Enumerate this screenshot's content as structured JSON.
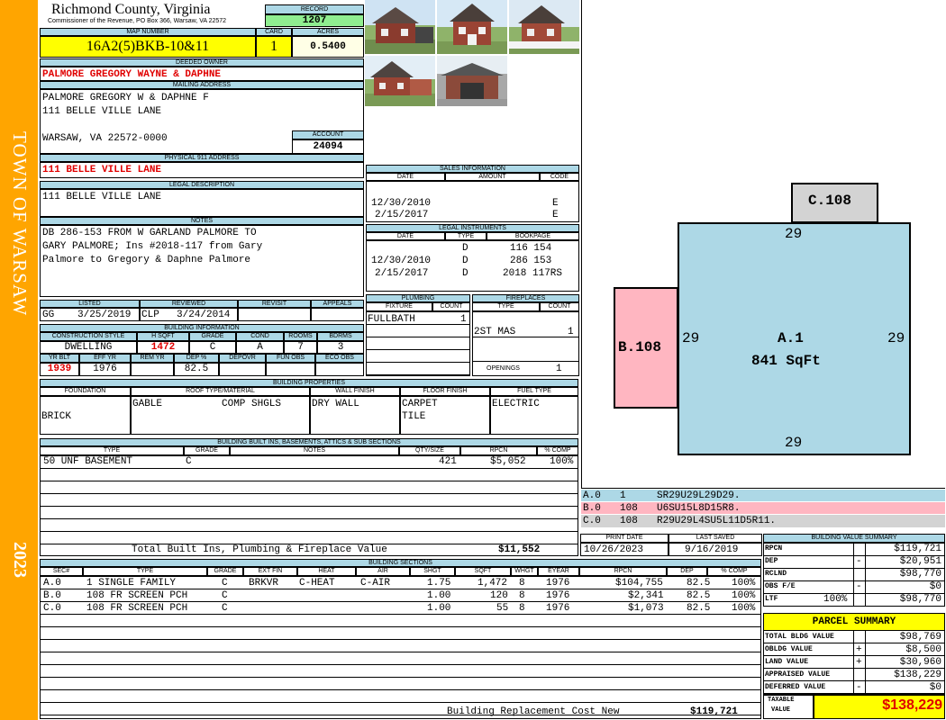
{
  "sidebar": {
    "town": "TOWN OF WARSAW",
    "year": "2023"
  },
  "header": {
    "county": "Richmond County, Virginia",
    "commissioner": "Commissioner of the Revenue, PO Box 366, Warsaw, VA 22572",
    "record_label": "RECORD",
    "record": "1207"
  },
  "parcel": {
    "map_number_label": "MAP NUMBER",
    "map_number": "16A2(5)BKB-10&11",
    "card_label": "CARD",
    "card": "1",
    "acres_label": "ACRES",
    "acres": "0.5400"
  },
  "owner": {
    "label": "DEEDED OWNER",
    "name": "PALMORE GREGORY WAYNE & DAPHNE",
    "mailing_label": "MAILING ADDRESS",
    "mailing": [
      "PALMORE GREGORY W & DAPHNE F",
      "111 BELLE VILLE LANE",
      "WARSAW, VA 22572-0000"
    ],
    "account_label": "ACCOUNT",
    "account": "24094"
  },
  "physical": {
    "label": "PHYSICAL 911 ADDRESS",
    "address": "111 BELLE VILLE LANE"
  },
  "legal": {
    "label": "LEGAL DESCRIPTION",
    "text": "111 BELLE VILLE LANE"
  },
  "notes": {
    "label": "NOTES",
    "lines": [
      "DB 286-153 FROM W GARLAND PALMORE TO",
      "GARY PALMORE; Ins #2018-117 from Gary",
      "Palmore to Gregory & Daphne Palmore"
    ]
  },
  "review": {
    "listed_label": "LISTED",
    "reviewed_label": "REVIEWED",
    "revisit_label": "REVISIT",
    "appeals_label": "APPEALS",
    "listed_by": "GG",
    "listed_date": "3/25/2019",
    "reviewed_by": "CLP",
    "reviewed_date": "3/24/2014"
  },
  "building_info": {
    "label": "BUILDING INFORMATION",
    "row1_labels": [
      "CONSTRUCTION STYLE",
      "H SQFT",
      "GRADE",
      "COND",
      "ROOMS",
      "BDRMS"
    ],
    "row1_values": [
      "DWELLING",
      "1472",
      "C",
      "A",
      "7",
      "3"
    ],
    "row2_labels": [
      "YR BLT",
      "EFF YR",
      "REM YR",
      "DEP %",
      "DEPOVR",
      "FUN OBS",
      "ECO OBS"
    ],
    "row2_values": [
      "1939",
      "1976",
      "",
      "82.5",
      "",
      "",
      ""
    ]
  },
  "sales": {
    "label": "SALES INFORMATION",
    "columns": [
      "DATE",
      "AMOUNT",
      "CODE"
    ],
    "rows": [
      {
        "date": "12/30/2010",
        "amount": "",
        "code": "E"
      },
      {
        "date": "2/15/2017",
        "amount": "",
        "code": "E"
      }
    ]
  },
  "instruments": {
    "label": "LEGAL INSTRUMENTS",
    "columns": [
      "DATE",
      "TYPE",
      "BOOKPAGE"
    ],
    "rows": [
      {
        "date": "",
        "type": "D",
        "bookpage": "116 154"
      },
      {
        "date": "12/30/2010",
        "type": "D",
        "bookpage": "286 153"
      },
      {
        "date": "2/15/2017",
        "type": "D",
        "bookpage": "2018 117RS"
      }
    ]
  },
  "plumbing": {
    "label": "PLUMBING",
    "columns": [
      "FIXTURE",
      "COUNT"
    ],
    "rows": [
      {
        "fixture": "FULLBATH",
        "count": "1"
      }
    ]
  },
  "fireplaces": {
    "label": "FIREPLACES",
    "columns": [
      "TYPE",
      "COUNT"
    ],
    "rows": [
      {
        "type": "2ST MAS",
        "count": "1"
      }
    ],
    "openings_label": "OPENINGS",
    "openings": "1"
  },
  "properties": {
    "label": "BUILDING PROPERTIES",
    "columns": [
      "FOUNDATION",
      "ROOF TYPE/MATERIAL",
      "WALL FINISH",
      "FLOOR FINISH",
      "FUEL TYPE"
    ],
    "foundation": "BRICK",
    "roof_type": "GABLE",
    "roof_material": "COMP SHGLS",
    "wall_finish": "DRY WALL",
    "floor_finish": [
      "CARPET",
      "TILE"
    ],
    "fuel_type": "ELECTRIC"
  },
  "builtins": {
    "label": "BUILDING BUILT INS, BASEMENTS, ATTICS & SUB SECTIONS",
    "columns": [
      "TYPE",
      "GRADE",
      "NOTES",
      "QTY/SIZE",
      "RPCN",
      "% COMP"
    ],
    "rows": [
      {
        "type": "50 UNF BASEMENT",
        "grade": "C",
        "notes": "",
        "qty": "421",
        "rpcn": "$5,052",
        "pct": "100%"
      }
    ],
    "total_label": "Total Built Ins, Plumbing & Fireplace Value",
    "total": "$11,552"
  },
  "sections": {
    "label": "BUILDING SECTIONS",
    "columns": [
      "SEC#",
      "TYPE",
      "GRADE",
      "EXT FIN",
      "HEAT",
      "AIR",
      "SHGT",
      "SQFT",
      "WHGT",
      "EYEAR",
      "RPCN",
      "DEP",
      "% COMP"
    ],
    "rows": [
      {
        "sec": "A.0",
        "type": "1 SINGLE FAMILY",
        "grade": "C",
        "ext": "BRKVR",
        "heat": "C-HEAT",
        "air": "C-AIR",
        "shgt": "1.75",
        "sqft": "1,472",
        "whgt": "8",
        "eyear": "1976",
        "rpcn": "$104,755",
        "dep": "82.5",
        "pct": "100%"
      },
      {
        "sec": "B.0",
        "type": "108 FR SCREEN PCH",
        "grade": "C",
        "ext": "",
        "heat": "",
        "air": "",
        "shgt": "1.00",
        "sqft": "120",
        "whgt": "8",
        "eyear": "1976",
        "rpcn": "$2,341",
        "dep": "82.5",
        "pct": "100%"
      },
      {
        "sec": "C.0",
        "type": "108 FR SCREEN PCH",
        "grade": "C",
        "ext": "",
        "heat": "",
        "air": "",
        "shgt": "1.00",
        "sqft": "55",
        "whgt": "8",
        "eyear": "1976",
        "rpcn": "$1,073",
        "dep": "82.5",
        "pct": "100%"
      }
    ],
    "footer_label": "Building Replacement Cost New",
    "footer": "$119,721"
  },
  "sketch": {
    "section_c": "C.108",
    "section_b": "B.108",
    "section_a": "A.1",
    "section_a_area": "841 SqFt",
    "dim_top": "29",
    "dim_left": "29",
    "dim_right": "29",
    "dim_bottom": "29",
    "legend": [
      {
        "sec": "A.0",
        "code": "1",
        "vector": "SR29U29L29D29.",
        "color": "#add8e6"
      },
      {
        "sec": "B.0",
        "code": "108",
        "vector": "U6SU15L8D15R8.",
        "color": "#ffb6c1"
      },
      {
        "sec": "C.0",
        "code": "108",
        "vector": "R29U29L4SU5L11D5R11.",
        "color": "#d3d3d3"
      }
    ]
  },
  "dates": {
    "print_label": "PRINT DATE",
    "print": "10/26/2023",
    "saved_label": "LAST SAVED",
    "saved": "9/16/2019"
  },
  "value_summary": {
    "label": "BUILDING VALUE SUMMARY",
    "rows": [
      {
        "label": "RPCN",
        "sign": "",
        "extra": "",
        "value": "$119,721"
      },
      {
        "label": "DEP",
        "sign": "-",
        "extra": "",
        "value": "$20,951"
      },
      {
        "label": "RCLND",
        "sign": "",
        "extra": "",
        "value": "$98,770"
      },
      {
        "label": "OBS F/E",
        "sign": "-",
        "extra": "",
        "value": "$0"
      },
      {
        "label": "LTF",
        "sign": "",
        "extra": "100%",
        "value": "$98,770"
      }
    ]
  },
  "parcel_summary": {
    "title": "PARCEL SUMMARY",
    "rows": [
      {
        "label": "TOTAL BLDG VALUE",
        "sign": "",
        "value": "$98,769"
      },
      {
        "label": "OBLDG VALUE",
        "sign": "+",
        "value": "$8,500"
      },
      {
        "label": "LAND VALUE",
        "sign": "+",
        "value": "$30,960"
      },
      {
        "label": "APPRAISED VALUE",
        "sign": "",
        "value": "$138,229"
      },
      {
        "label": "DEFERRED VALUE",
        "sign": "-",
        "value": "$0"
      }
    ],
    "taxable_label": [
      "TAXABLE",
      "VALUE"
    ],
    "taxable": "$138,229"
  },
  "colors": {
    "header_bg": "#add8e6",
    "highlight": "#ffff00",
    "record_bg": "#90ee90",
    "sidebar": "#ffa500",
    "alert_text": "#e00000"
  }
}
